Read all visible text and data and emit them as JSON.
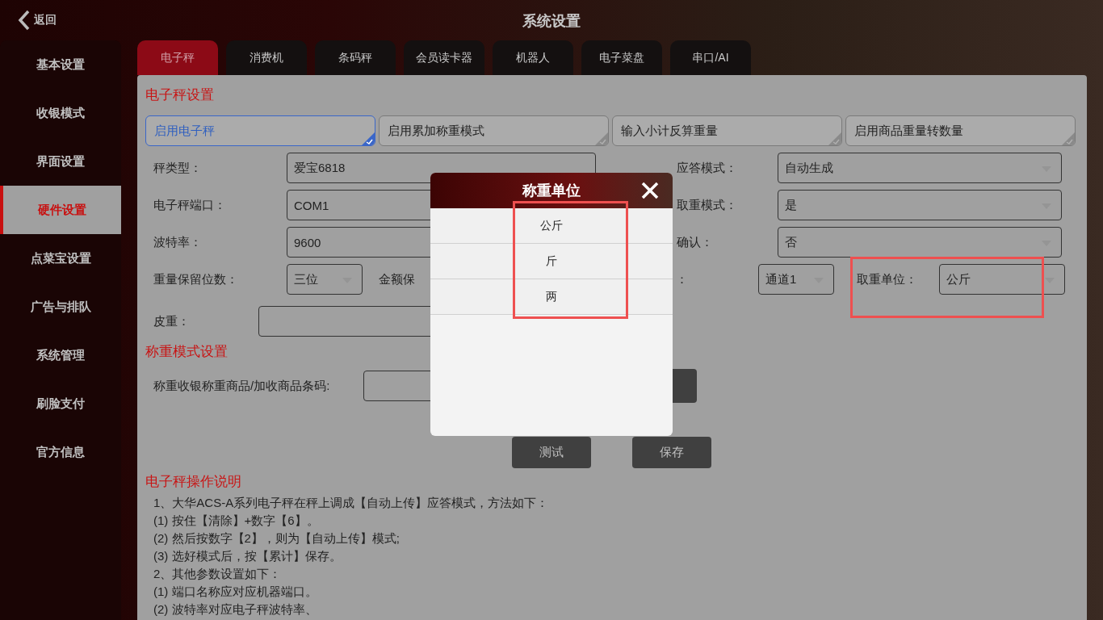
{
  "header": {
    "back": "返回",
    "title": "系统设置"
  },
  "sidebar": {
    "items": [
      {
        "label": "基本设置",
        "selected": false
      },
      {
        "label": "收银模式",
        "selected": false
      },
      {
        "label": "界面设置",
        "selected": false
      },
      {
        "label": "硬件设置",
        "selected": true
      },
      {
        "label": "点菜宝设置",
        "selected": false
      },
      {
        "label": "广告与排队",
        "selected": false
      },
      {
        "label": "系统管理",
        "selected": false
      },
      {
        "label": "刷脸支付",
        "selected": false
      },
      {
        "label": "官方信息",
        "selected": false
      }
    ]
  },
  "tabs": [
    {
      "label": "电子秤",
      "selected": true
    },
    {
      "label": "消费机",
      "selected": false
    },
    {
      "label": "条码秤",
      "selected": false
    },
    {
      "label": "会员读卡器",
      "selected": false
    },
    {
      "label": "机器人",
      "selected": false
    },
    {
      "label": "电子菜盘",
      "selected": false
    },
    {
      "label": "串口/AI",
      "selected": false
    }
  ],
  "scale_settings": {
    "title": "电子秤设置",
    "toggles": [
      {
        "label": "启用电子秤",
        "checked": true
      },
      {
        "label": "启用累加称重模式",
        "checked": false
      },
      {
        "label": "输入小计反算重量",
        "checked": false
      },
      {
        "label": "启用商品重量转数量",
        "checked": false
      }
    ],
    "rows": [
      {
        "label": "秤类型：",
        "value": "爱宝6818",
        "right_label": "应答模式：",
        "right_value": "自动生成"
      },
      {
        "label": "电子秤端口：",
        "value": "COM1",
        "right_label": "取重模式：",
        "right_value": "是"
      },
      {
        "label": "波特率：",
        "value": "9600",
        "right_label": "确认：",
        "right_value": "否"
      }
    ],
    "weight_decimals": {
      "label": "重量保留位数：",
      "value": "三位"
    },
    "amount_decimals_label": "金额保",
    "channel": {
      "label": "：",
      "value": "通道1"
    },
    "weigh_unit": {
      "label": "取重单位：",
      "value": "公斤"
    },
    "tare": {
      "label": "皮重："
    }
  },
  "weigh_mode": {
    "title": "称重模式设置",
    "barcode_label": "称重收银称重商品/加收商品条码:"
  },
  "buttons": [
    "测试",
    "保存"
  ],
  "instructions": {
    "title": "电子秤操作说明",
    "lines": [
      "1、大华ACS-A系列电子秤在秤上调成【自动上传】应答模式，方法如下：",
      "(1) 按住【清除】+数字【6】。",
      "(2) 然后按数字【2】，则为【自动上传】模式;",
      "(3) 选好模式后，按【累计】保存。",
      "2、其他参数设置如下：",
      "(1) 端口名称应对应机器端口。",
      "(2) 波特率对应电子秤波特率、"
    ]
  },
  "modal": {
    "title": "称重单位",
    "options": [
      "公斤",
      "斤",
      "两"
    ]
  }
}
